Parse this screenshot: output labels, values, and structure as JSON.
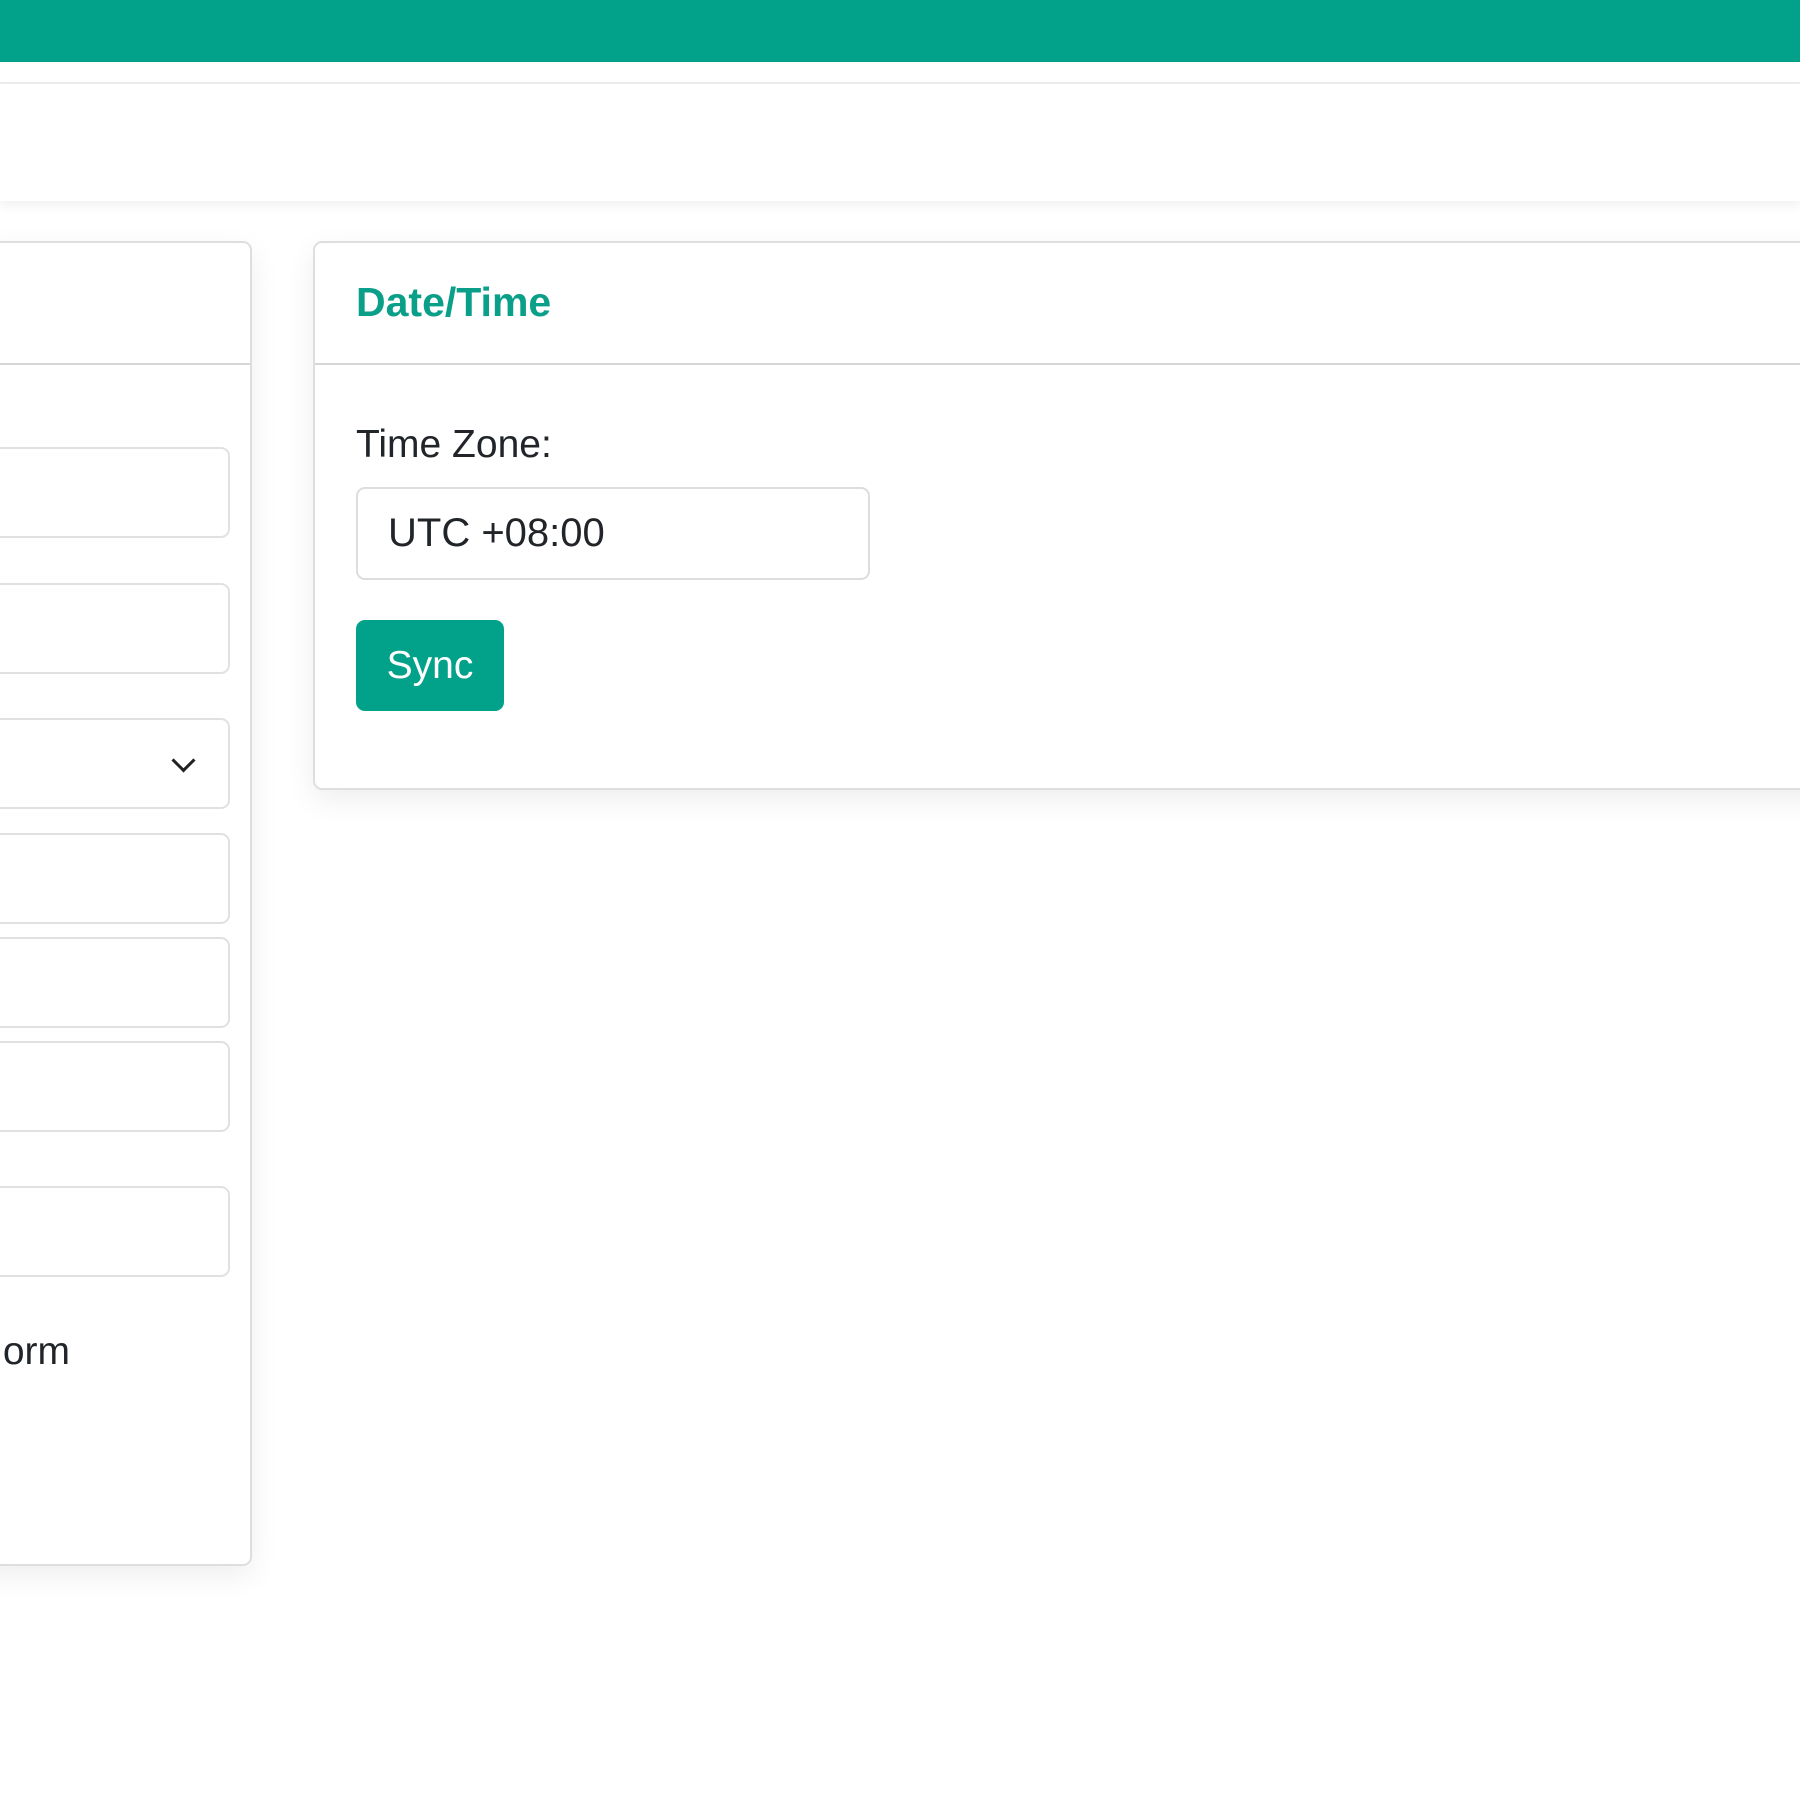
{
  "colors": {
    "accent": "#02a18a",
    "title": "#0a9f88"
  },
  "left_card": {
    "fields": [
      {
        "type": "input",
        "value": ""
      },
      {
        "type": "input",
        "value": ""
      },
      {
        "type": "select",
        "value": "",
        "icon": "chevron-down-icon"
      },
      {
        "type": "input",
        "value": ""
      },
      {
        "type": "input",
        "value": ""
      },
      {
        "type": "input",
        "value": ""
      },
      {
        "type": "input",
        "value": ""
      }
    ],
    "trailing_text": "orm"
  },
  "datetime_card": {
    "title": "Date/Time",
    "timezone_label": "Time Zone:",
    "timezone_value": "UTC +08:00",
    "sync_label": "Sync"
  }
}
